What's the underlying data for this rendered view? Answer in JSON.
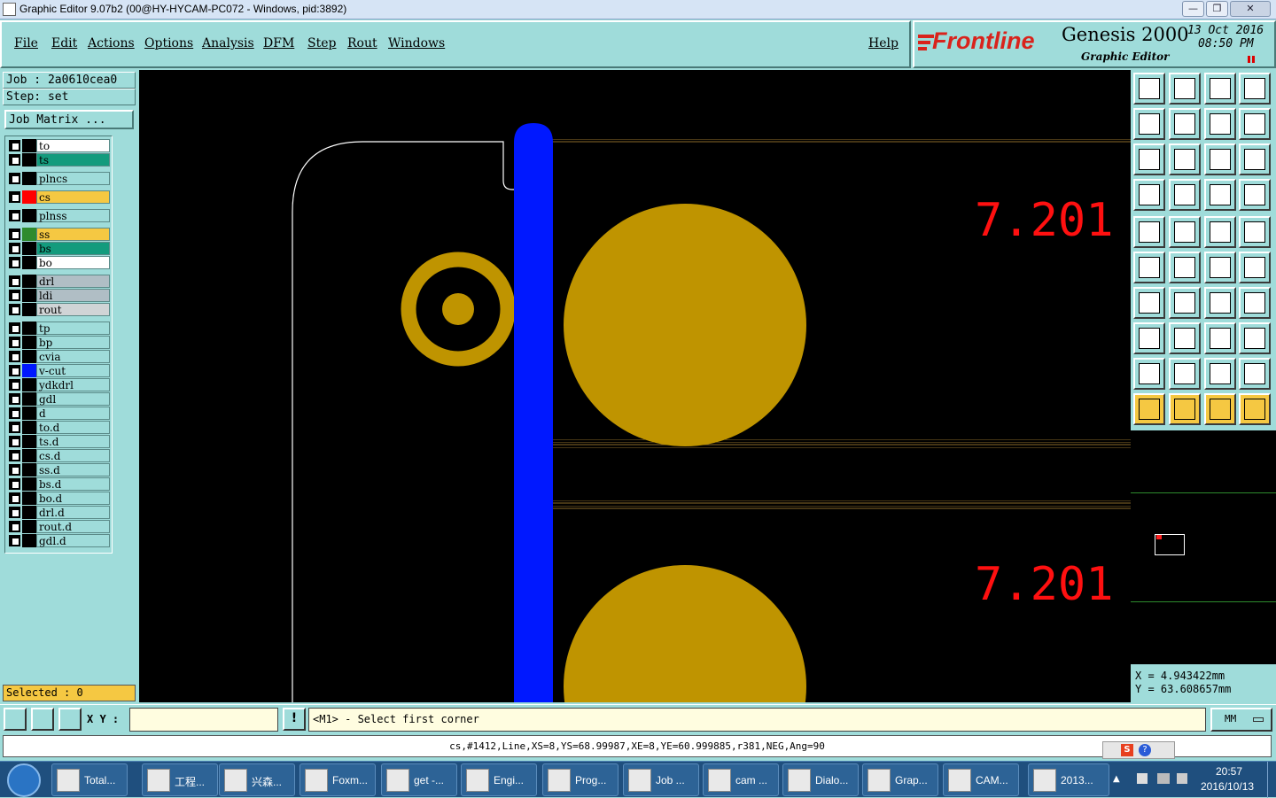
{
  "window": {
    "title": "Graphic Editor 9.07b2 (00@HY-HYCAM-PC072 - Windows, pid:3892)"
  },
  "menu": [
    "File",
    "Edit",
    "Actions",
    "Options",
    "Analysis",
    "DFM",
    "Step",
    "Rout",
    "Windows"
  ],
  "help": "Help",
  "brand": {
    "logo": "Frontline",
    "product": "Genesis 2000",
    "sub": "Graphic Editor",
    "date": "13 Oct 2016",
    "time": "08:50 PM"
  },
  "job": {
    "job_line": "Job : 2a0610cea0",
    "step_line": "Step: set",
    "matrix_button": "Job Matrix ..."
  },
  "layers": [
    {
      "name": "to",
      "color": "#ffffff",
      "swatch": "#000000"
    },
    {
      "name": "ts",
      "color": "#139b7d",
      "swatch": "#000000"
    },
    {
      "name": "plncs",
      "color": "#9fdcda",
      "swatch": "#000000"
    },
    {
      "name": "cs",
      "color": "#f5c842",
      "swatch": "#ff0000"
    },
    {
      "name": "plnss",
      "color": "#9fdcda",
      "swatch": "#000000"
    },
    {
      "name": "ss",
      "color": "#f5c842",
      "swatch": "#2e8b2e"
    },
    {
      "name": "bs",
      "color": "#139b7d",
      "swatch": "#000000"
    },
    {
      "name": "bo",
      "color": "#ffffff",
      "swatch": "#000000"
    },
    {
      "name": "drl",
      "color": "#b0bec5",
      "swatch": "#000000"
    },
    {
      "name": "ldi",
      "color": "#b0bec5",
      "swatch": "#000000"
    },
    {
      "name": "rout",
      "color": "#d0d4d6",
      "swatch": "#000000"
    },
    {
      "name": "tp",
      "color": "#9fdcda",
      "swatch": "#000000"
    },
    {
      "name": "bp",
      "color": "#9fdcda",
      "swatch": "#000000"
    },
    {
      "name": "cvia",
      "color": "#9fdcda",
      "swatch": "#000000"
    },
    {
      "name": "v-cut",
      "color": "#9fdcda",
      "swatch": "#0018ff"
    },
    {
      "name": "ydkdrl",
      "color": "#9fdcda",
      "swatch": "#000000"
    },
    {
      "name": "gdl",
      "color": "#9fdcda",
      "swatch": "#000000"
    },
    {
      "name": "d",
      "color": "#9fdcda",
      "swatch": "#000000"
    },
    {
      "name": "to.d",
      "color": "#9fdcda",
      "swatch": "#000000"
    },
    {
      "name": "ts.d",
      "color": "#9fdcda",
      "swatch": "#000000"
    },
    {
      "name": "cs.d",
      "color": "#9fdcda",
      "swatch": "#000000"
    },
    {
      "name": "ss.d",
      "color": "#9fdcda",
      "swatch": "#000000"
    },
    {
      "name": "bs.d",
      "color": "#9fdcda",
      "swatch": "#000000"
    },
    {
      "name": "bo.d",
      "color": "#9fdcda",
      "swatch": "#000000"
    },
    {
      "name": "drl.d",
      "color": "#9fdcda",
      "swatch": "#000000"
    },
    {
      "name": "rout.d",
      "color": "#9fdcda",
      "swatch": "#000000"
    },
    {
      "name": "gdl.d",
      "color": "#9fdcda",
      "swatch": "#000000"
    }
  ],
  "selected": "Selected : 0",
  "canvas": {
    "dim1": "7.201",
    "dim2": "7.201",
    "copper": "#bf9400",
    "vcut": "#0018ff"
  },
  "coords": {
    "x": "X = 4.943422mm",
    "y": "Y = 63.608657mm"
  },
  "bottom": {
    "xy_label": "X Y :",
    "xy_value": "",
    "prompt": "<M1> - Select first corner",
    "units": "MM"
  },
  "status": "cs,#1412,Line,XS=8,YS=68.99987,XE=8,YE=60.999885,r381,NEG,Ang=90",
  "taskbar": {
    "items": [
      "Total...",
      "工程...",
      "兴森...",
      "Foxm...",
      "get -...",
      "Engi...",
      "Prog...",
      "Job ...",
      "cam ...",
      "Dialo...",
      "Grap...",
      "CAM...",
      "2013..."
    ],
    "time": "20:57",
    "date": "2016/10/13"
  }
}
